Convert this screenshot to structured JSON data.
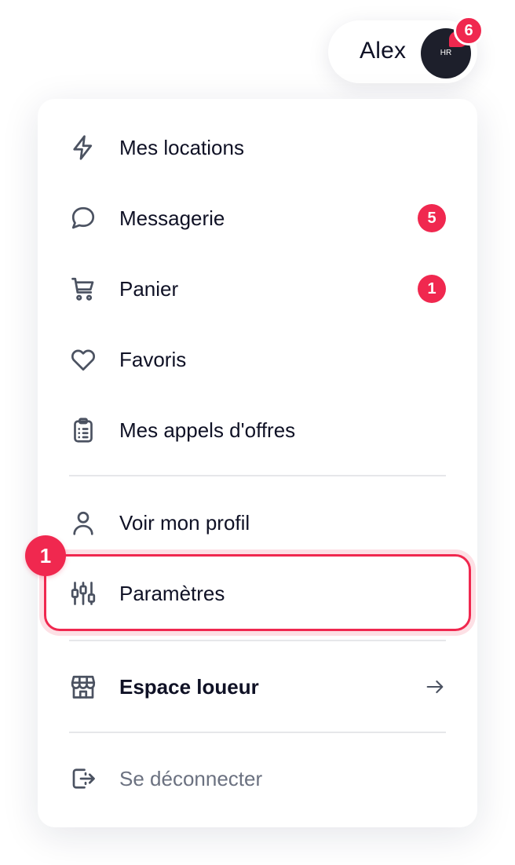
{
  "header": {
    "user_name": "Alex",
    "avatar_initials": "HR",
    "notification_count": "6"
  },
  "menu": {
    "items": [
      {
        "label": "Mes locations",
        "icon": "lightning-icon"
      },
      {
        "label": "Messagerie",
        "icon": "chat-bubble-icon",
        "badge": "5"
      },
      {
        "label": "Panier",
        "icon": "cart-icon",
        "badge": "1"
      },
      {
        "label": "Favoris",
        "icon": "heart-icon"
      },
      {
        "label": "Mes appels d'offres",
        "icon": "clipboard-icon"
      },
      {
        "label": "Voir mon profil",
        "icon": "user-icon"
      },
      {
        "label": "Paramètres",
        "icon": "sliders-icon"
      },
      {
        "label": "Espace loueur",
        "icon": "storefront-icon"
      },
      {
        "label": "Se déconnecter",
        "icon": "logout-icon"
      }
    ]
  },
  "annotation": {
    "step_number": "1"
  },
  "colors": {
    "accent": "#f0284f",
    "text": "#0f1125",
    "icon": "#4b5261",
    "muted": "#6b7180",
    "divider": "#e6e7ea"
  }
}
